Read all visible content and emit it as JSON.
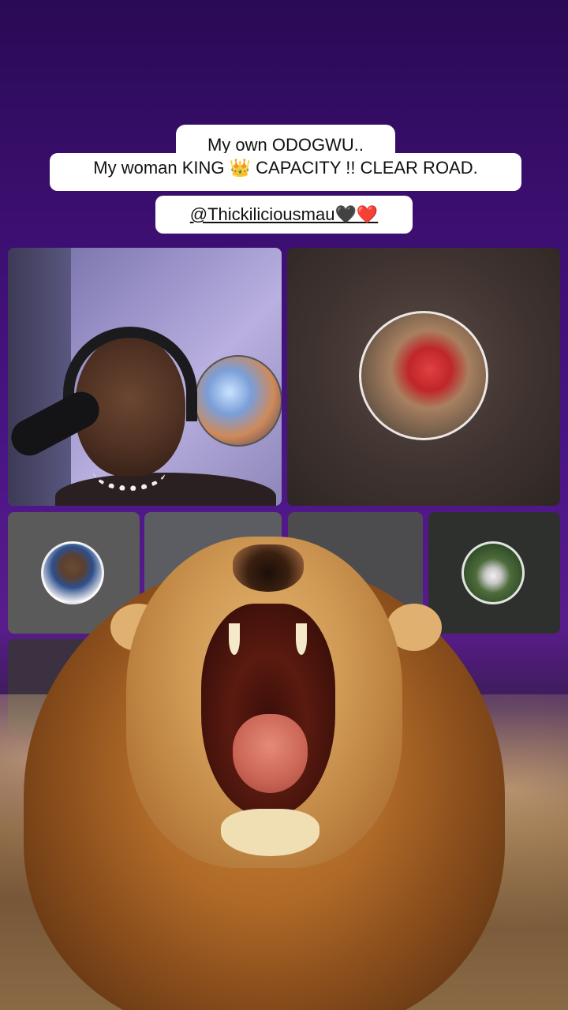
{
  "caption": {
    "line1": "My own ODOGWU..",
    "line2": "My woman KING 👑  CAPACITY !! CLEAR ROAD.",
    "mention": "@Thickiliciousmau🖤❤️"
  },
  "participants": [
    {
      "role": "main-speaker"
    },
    {
      "role": "co-host"
    },
    {
      "role": "guest-1"
    },
    {
      "role": "guest-2"
    },
    {
      "role": "guest-3"
    },
    {
      "role": "guest-4"
    },
    {
      "role": "guest-5"
    }
  ],
  "effects": {
    "overlay_icon": "roaring-lion-gift"
  },
  "colors": {
    "background": "#3a0e6e",
    "caption_bg": "#ffffff"
  }
}
